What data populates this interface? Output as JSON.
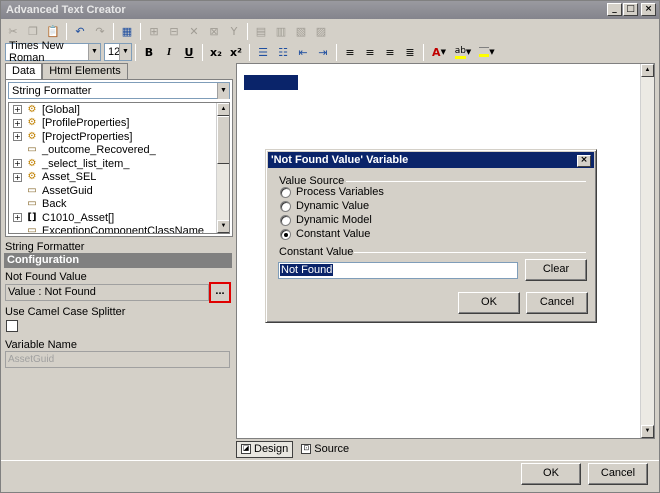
{
  "window": {
    "title": "Advanced Text Creator",
    "minimize": "_",
    "maximize": "□",
    "close": "×"
  },
  "toolbar1": {
    "icons": [
      "cut-icon",
      "copy-icon",
      "paste-icon",
      "undo-icon",
      "redo-icon",
      "table-icon",
      "insert-row-icon",
      "insert-col-icon",
      "delete-row-icon",
      "delete-col-icon",
      "merge-icon",
      "split-icon",
      "cell-props-icon"
    ]
  },
  "toolbar2": {
    "font_name": "Times New Roman",
    "font_size": "12",
    "bold": "B",
    "italic": "I",
    "underline": "U",
    "subscript": "x₂",
    "superscript": "x²",
    "font_color": "A",
    "highlight": "ab"
  },
  "left": {
    "tabs": [
      "Data",
      "Html Elements"
    ],
    "formatter": "String Formatter",
    "tree": [
      {
        "label": "[Global]",
        "expand": true,
        "icon": "var-group-icon"
      },
      {
        "label": "[ProfileProperties]",
        "expand": true,
        "icon": "var-group-icon"
      },
      {
        "label": "[ProjectProperties]",
        "expand": true,
        "icon": "var-group-icon"
      },
      {
        "label": "_outcome_Recovered_",
        "expand": false,
        "icon": "variable-icon"
      },
      {
        "label": "_select_list_item_",
        "expand": true,
        "icon": "var-group-icon"
      },
      {
        "label": "Asset_SEL",
        "expand": true,
        "icon": "var-group-icon"
      },
      {
        "label": "AssetGuid",
        "expand": false,
        "icon": "variable-icon"
      },
      {
        "label": "Back",
        "expand": false,
        "icon": "variable-icon"
      },
      {
        "label": "C1010_Asset[]",
        "expand": true,
        "icon": "array-icon"
      },
      {
        "label": "ExceptionComponentClassName",
        "expand": false,
        "icon": "variable-icon"
      }
    ],
    "props": {
      "formatter_label": "String Formatter",
      "config_section": "Configuration",
      "not_found_label": "Not Found Value",
      "not_found_value": "Value : Not Found",
      "dots": "...",
      "camel_label": "Use Camel Case Splitter",
      "varname_label": "Variable Name",
      "varname_value": "AssetGuid"
    }
  },
  "bottom_tabs": {
    "design": "Design",
    "source": "Source"
  },
  "footer": {
    "ok": "OK",
    "cancel": "Cancel"
  },
  "dialog": {
    "title": "'Not Found Value' Variable",
    "value_source_label": "Value Source",
    "options": [
      {
        "label": "Process Variables",
        "checked": false
      },
      {
        "label": "Dynamic Value",
        "checked": false
      },
      {
        "label": "Dynamic Model",
        "checked": false
      },
      {
        "label": "Constant Value",
        "checked": true
      }
    ],
    "constant_label": "Constant Value",
    "constant_value": "Not Found",
    "clear": "Clear",
    "ok": "OK",
    "cancel": "Cancel"
  }
}
